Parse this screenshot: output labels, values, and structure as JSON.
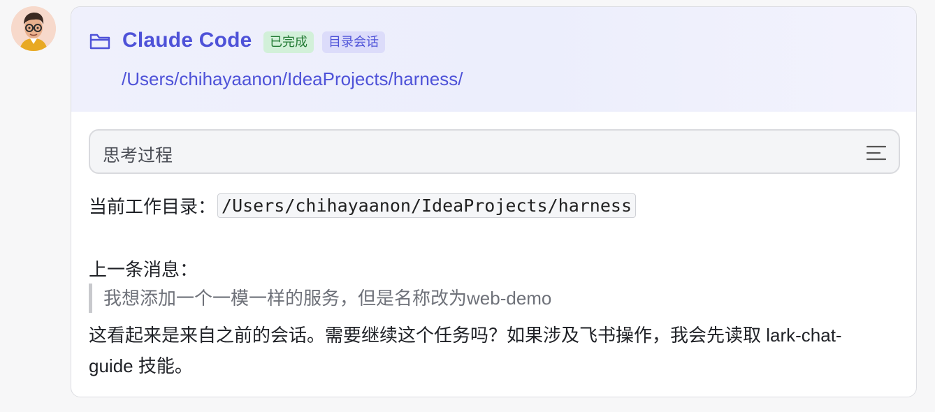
{
  "avatar": {
    "icon": "user-avatar"
  },
  "header": {
    "folder_icon": "folder-icon",
    "title": "Claude Code",
    "badges": {
      "status": "已完成",
      "session_type": "目录会话"
    },
    "path": "/Users/chihayaanon/IdeaProjects/harness/"
  },
  "thinking": {
    "label": "思考过程",
    "icon": "menu-lines-icon"
  },
  "body": {
    "cwd_label": "当前工作目录：",
    "cwd_value": "/Users/chihayaanon/IdeaProjects/harness",
    "prev_label": "上一条消息：",
    "prev_message": "我想添加一个一模一样的服务，但是名称改为web-demo",
    "reply": "这看起来是来自之前的会话。需要继续这个任务吗？如果涉及飞书操作，我会先读取 lark-chat-guide 技能。"
  },
  "colors": {
    "accent": "#4e52d8",
    "done_badge_bg": "#d2f0d9",
    "done_badge_text": "#237a35",
    "dir_badge_bg": "#dcdcfa"
  }
}
